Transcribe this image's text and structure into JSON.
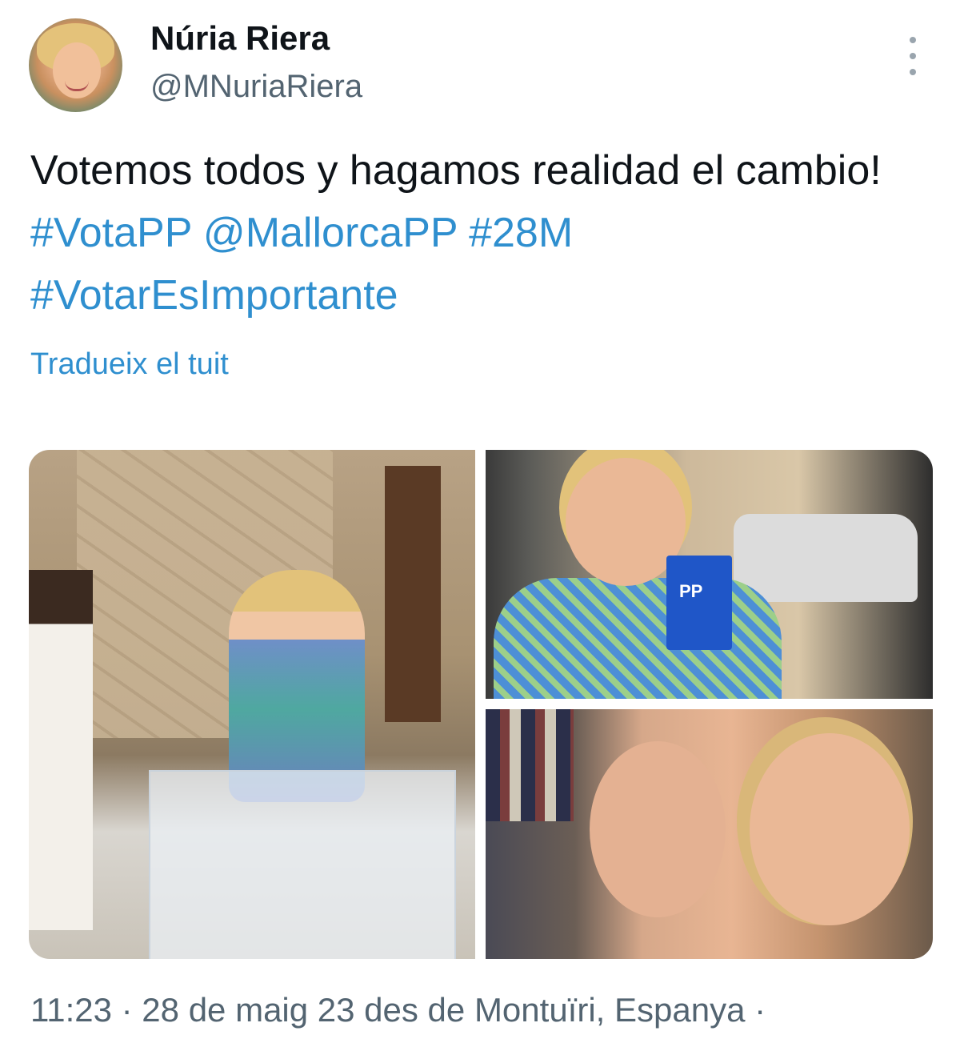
{
  "author": {
    "display_name": "Núria Riera",
    "handle": "@MNuriaRiera"
  },
  "icons": {
    "more": "more-vertical-icon"
  },
  "tweet": {
    "text_plain": "Votemos todos y hagamos realidad el cambio! ",
    "links": [
      "#VotaPP",
      "@MallorcaPP",
      "#28M",
      "#VotarEsImportante"
    ]
  },
  "translate_label": "Tradueix el tuit",
  "media": {
    "photos": [
      "photo-1",
      "photo-2",
      "photo-3"
    ],
    "badge_text": "PP"
  },
  "footer": {
    "timestamp": "11:23 · 28 de maig 23 des de Montuïri, Espanya ·"
  },
  "colors": {
    "text": "#0f1419",
    "secondary": "#536471",
    "link": "#2f8fcf"
  }
}
